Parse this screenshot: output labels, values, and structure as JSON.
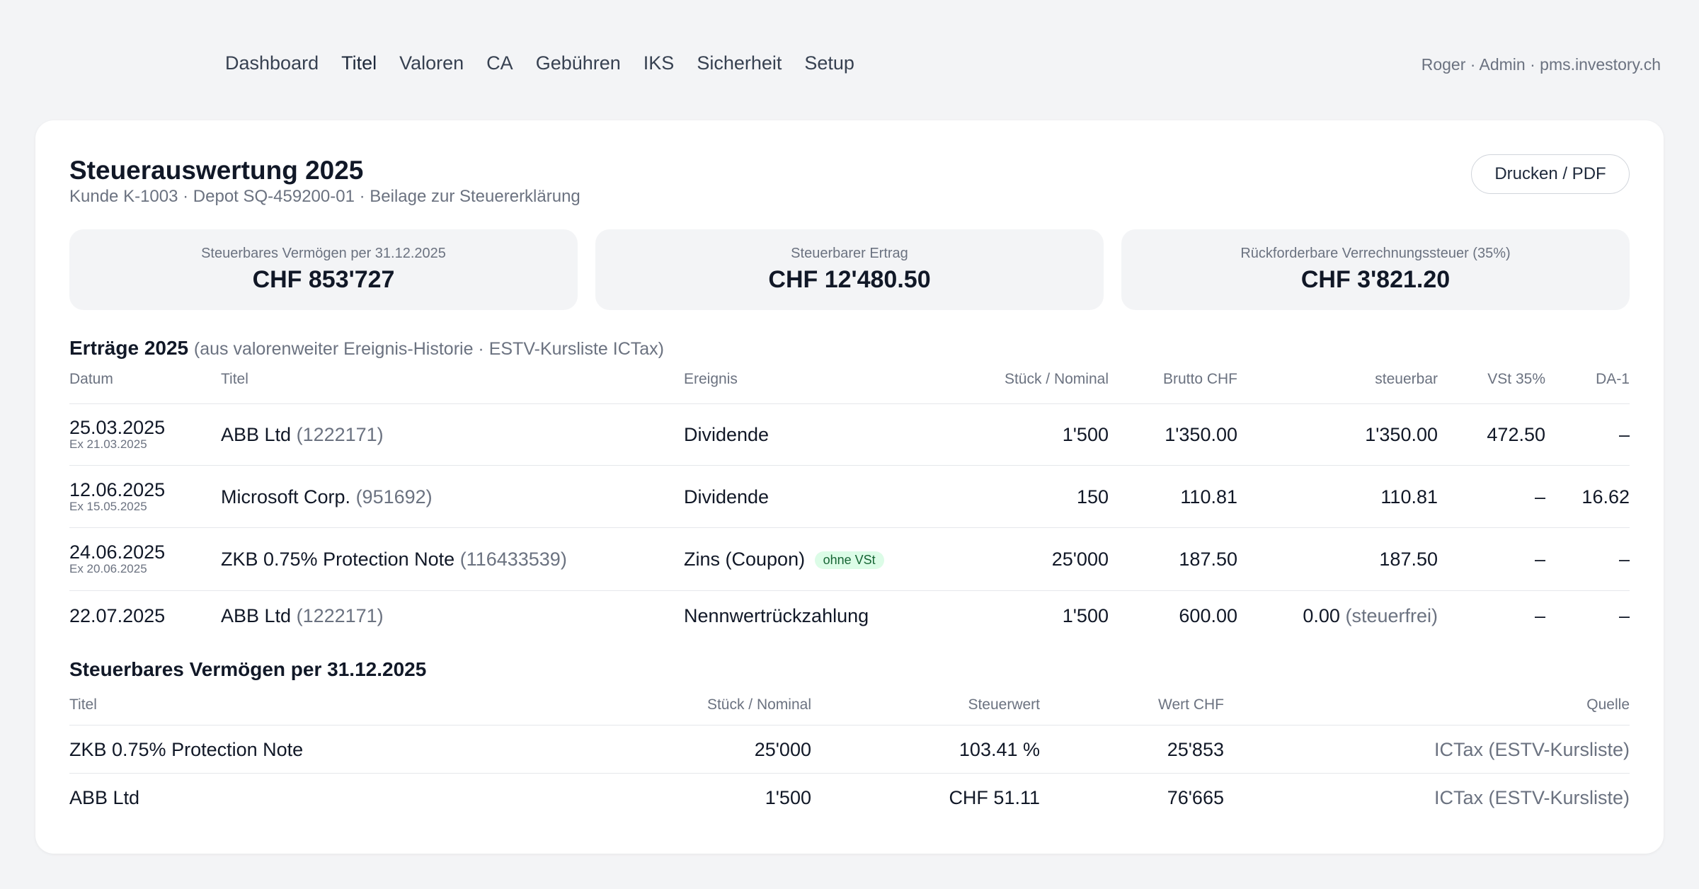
{
  "nav": {
    "items": [
      "Dashboard",
      "Titel",
      "Valoren",
      "CA",
      "Gebühren",
      "IKS",
      "Sicherheit",
      "Setup"
    ],
    "active": "Titel"
  },
  "user": "Roger · Admin · pms.investory.ch",
  "header": {
    "title": "Steuerauswertung 2025",
    "subtitle": "Kunde K-1003 · Depot SQ-459200-01 · Beilage zur Steuererklärung",
    "print_label": "Drucken / PDF"
  },
  "kpis": [
    {
      "label": "Steuerbares Vermögen per 31.12.2025",
      "value": "CHF 853'727"
    },
    {
      "label": "Steuerbarer Ertrag",
      "value": "CHF 12'480.50"
    },
    {
      "label": "Rückforderbare Verrechnungssteuer (35%)",
      "value": "CHF 3'821.20"
    }
  ],
  "income": {
    "title": "Erträge 2025",
    "note": "(aus valorenweiter Ereignis-Historie · ESTV-Kursliste ICTax)",
    "columns": {
      "date": "Datum",
      "title": "Titel",
      "event": "Ereignis",
      "qty": "Stück / Nominal",
      "gross": "Brutto CHF",
      "taxable": "steuerbar",
      "vst": "VSt 35%",
      "da1": "DA-1"
    },
    "rows": [
      {
        "date": "25.03.2025",
        "ex": "Ex 21.03.2025",
        "name": "ABB Ltd",
        "valor": "(1222171)",
        "event": "Dividende",
        "badge": "",
        "qty": "1'500",
        "gross": "1'350.00",
        "taxable": "1'350.00",
        "taxable_note": "",
        "vst": "472.50",
        "da1": "–"
      },
      {
        "date": "12.06.2025",
        "ex": "Ex 15.05.2025",
        "name": "Microsoft Corp.",
        "valor": "(951692)",
        "event": "Dividende",
        "badge": "",
        "qty": "150",
        "gross": "110.81",
        "taxable": "110.81",
        "taxable_note": "",
        "vst": "–",
        "da1": "16.62"
      },
      {
        "date": "24.06.2025",
        "ex": "Ex 20.06.2025",
        "name": "ZKB 0.75% Protection Note",
        "valor": "(116433539)",
        "event": "Zins (Coupon)",
        "badge": "ohne VSt",
        "qty": "25'000",
        "gross": "187.50",
        "taxable": "187.50",
        "taxable_note": "",
        "vst": "–",
        "da1": "–"
      },
      {
        "date": "22.07.2025",
        "ex": "",
        "name": "ABB Ltd",
        "valor": "(1222171)",
        "event": "Nennwertrückzahlung",
        "badge": "",
        "qty": "1'500",
        "gross": "600.00",
        "taxable": "0.00",
        "taxable_note": "(steuerfrei)",
        "vst": "–",
        "da1": "–"
      }
    ]
  },
  "wealth": {
    "title": "Steuerbares Vermögen per 31.12.2025",
    "columns": {
      "title": "Titel",
      "qty": "Stück / Nominal",
      "taxvalue": "Steuerwert",
      "value": "Wert CHF",
      "source": "Quelle"
    },
    "rows": [
      {
        "name": "ZKB 0.75% Protection Note",
        "qty": "25'000",
        "taxvalue": "103.41 %",
        "value": "25'853",
        "source": "ICTax (ESTV-Kursliste)"
      },
      {
        "name": "ABB Ltd",
        "qty": "1'500",
        "taxvalue": "CHF 51.11",
        "value": "76'665",
        "source": "ICTax (ESTV-Kursliste)"
      }
    ]
  }
}
